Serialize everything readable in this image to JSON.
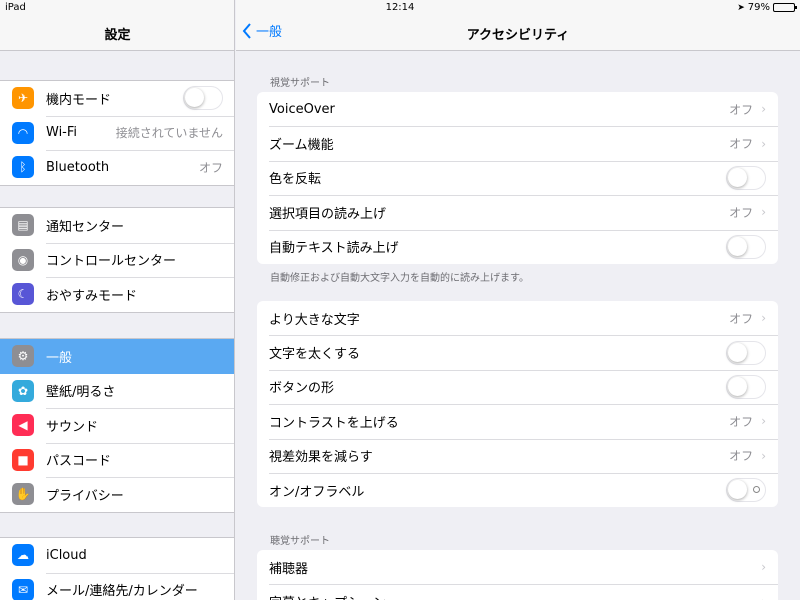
{
  "status": {
    "device": "iPad",
    "time": "12:14",
    "battery": "79%",
    "battery_level": 0.79
  },
  "sidebar": {
    "title": "設定",
    "groups": [
      [
        {
          "label": "機内モード",
          "icon": "airplane-icon",
          "color": "#ff9500",
          "toggle": false
        },
        {
          "label": "Wi-Fi",
          "icon": "wifi-icon",
          "color": "#007aff",
          "value": "接続されていません"
        },
        {
          "label": "Bluetooth",
          "icon": "bluetooth-icon",
          "color": "#007aff",
          "value": "オフ"
        }
      ],
      [
        {
          "label": "通知センター",
          "icon": "notification-center-icon",
          "color": "#8e8e93"
        },
        {
          "label": "コントロールセンター",
          "icon": "control-center-icon",
          "color": "#8e8e93"
        },
        {
          "label": "おやすみモード",
          "icon": "moon-icon",
          "color": "#5856d6"
        }
      ],
      [
        {
          "label": "一般",
          "icon": "gear-icon",
          "color": "#8e8e93",
          "selected": true
        },
        {
          "label": "壁紙/明るさ",
          "icon": "wallpaper-icon",
          "color": "#34aadc"
        },
        {
          "label": "サウンド",
          "icon": "speaker-icon",
          "color": "#ff2d55"
        },
        {
          "label": "パスコード",
          "icon": "lock-icon",
          "color": "#ff3b30"
        },
        {
          "label": "プライバシー",
          "icon": "hand-icon",
          "color": "#8e8e93"
        }
      ],
      [
        {
          "label": "iCloud",
          "icon": "cloud-icon",
          "color": "#007aff"
        },
        {
          "label": "メール/連絡先/カレンダー",
          "icon": "mail-icon",
          "color": "#007aff"
        }
      ]
    ]
  },
  "nav": {
    "back_label": "一般",
    "title": "アクセシビリティ"
  },
  "main": {
    "vision_header": "視覚サポート",
    "vision_footer": "自動修正および自動大文字入力を自動的に読み上げます。",
    "hearing_header": "聴覚サポート",
    "groups": [
      [
        {
          "label": "VoiceOver",
          "value": "オフ",
          "type": "disclosure"
        },
        {
          "label": "ズーム機能",
          "value": "オフ",
          "type": "disclosure"
        },
        {
          "label": "色を反転",
          "type": "toggle",
          "on": false
        },
        {
          "label": "選択項目の読み上げ",
          "value": "オフ",
          "type": "disclosure"
        },
        {
          "label": "自動テキスト読み上げ",
          "type": "toggle",
          "on": false
        }
      ],
      [
        {
          "label": "より大きな文字",
          "value": "オフ",
          "type": "disclosure"
        },
        {
          "label": "文字を太くする",
          "type": "toggle",
          "on": false
        },
        {
          "label": "ボタンの形",
          "type": "toggle",
          "on": false
        },
        {
          "label": "コントラストを上げる",
          "value": "オフ",
          "type": "disclosure"
        },
        {
          "label": "視差効果を減らす",
          "value": "オフ",
          "type": "disclosure"
        },
        {
          "label": "オン/オフラベル",
          "type": "toggle",
          "on": false,
          "show_label": true
        }
      ],
      [
        {
          "label": "補聴器",
          "type": "disclosure"
        },
        {
          "label": "字幕とキャプション",
          "type": "disclosure"
        }
      ]
    ]
  },
  "colors": {
    "accent": "#007aff",
    "selected_row": "#5aa9f2",
    "background": "#efeff4"
  }
}
